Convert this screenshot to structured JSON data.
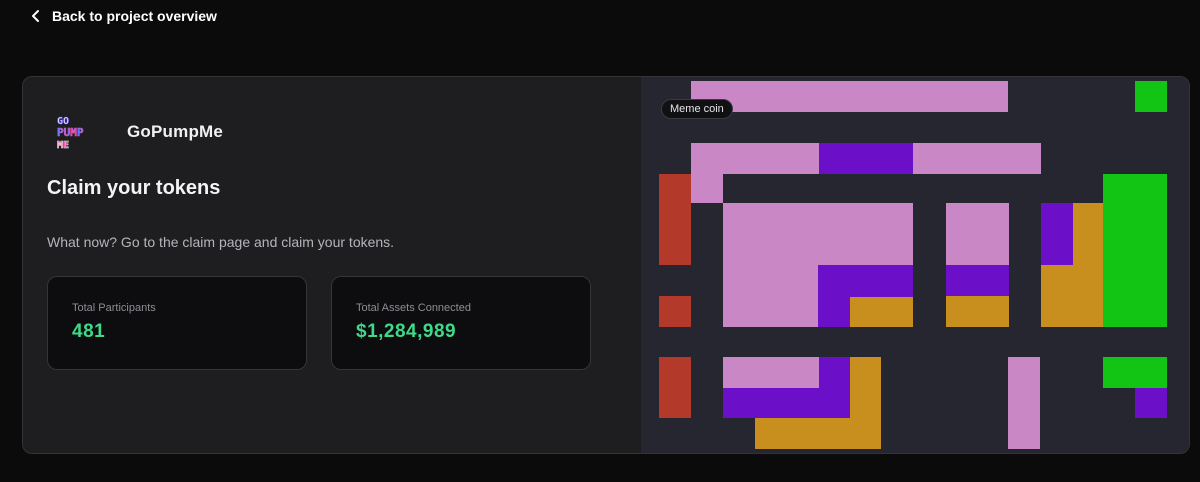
{
  "nav": {
    "back_label": "Back to project overview"
  },
  "project": {
    "logo_text": [
      "GO",
      "PUMP",
      "ME"
    ],
    "name": "GoPumpMe",
    "heading": "Claim your tokens",
    "description": "What now? Go to the claim page and claim your tokens."
  },
  "stats": [
    {
      "label": "Total Participants",
      "value": "481"
    },
    {
      "label": "Total Assets Connected",
      "value": "$1,284,989"
    }
  ],
  "artwork": {
    "tag": "Meme coin"
  },
  "colors": {
    "background": "#0b0b0c",
    "card": "#1e1e21",
    "accent_green": "#3fd98a",
    "pink": "#c987c6",
    "purple": "#6c0fc9",
    "orange": "#c98f1e",
    "red": "#b3392a",
    "green": "#12c414"
  }
}
